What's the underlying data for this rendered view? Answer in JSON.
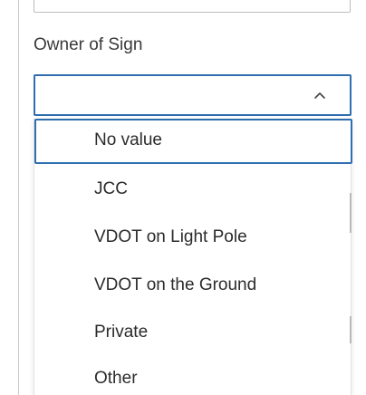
{
  "field": {
    "label": "Owner of Sign",
    "selected_value": ""
  },
  "dropdown": {
    "options": [
      {
        "label": "No value",
        "focused": true
      },
      {
        "label": "JCC"
      },
      {
        "label": "VDOT on Light Pole"
      },
      {
        "label": "VDOT on the Ground"
      },
      {
        "label": "Private"
      },
      {
        "label": "Other"
      }
    ]
  },
  "colors": {
    "focus_border": "#2f6fb0",
    "text": "#2b2b2b",
    "field_border": "#bdbdbd"
  },
  "icons": {
    "toggle": "chevron-up-icon"
  }
}
